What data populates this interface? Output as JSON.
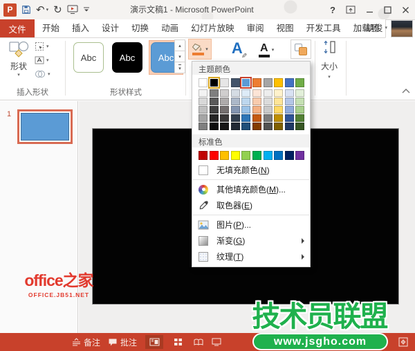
{
  "colors": {
    "accent": "#C8412B",
    "status_bar_bg": "#C8412B",
    "slide_fill_blue": "#5B9BD5",
    "fill_button_highlight": "#FADBC6",
    "watermark_red": "#E23A2E",
    "watermark_green": "#1FB14D"
  },
  "icons": {
    "powerpoint_logo": "P",
    "undo": "↶",
    "redo": "↻",
    "caret": "▾",
    "help": "?",
    "scroll_up": "▴",
    "scroll_down": "▾",
    "letter_a": "A",
    "pencil": "✎"
  },
  "title_bar": {
    "title": "演示文稿1 - Microsoft PowerPoint"
  },
  "tabs": {
    "file": "文件",
    "items": [
      "开始",
      "插入",
      "设计",
      "切换",
      "动画",
      "幻灯片放映",
      "审阅",
      "视图",
      "开发工具",
      "加载项"
    ],
    "contextual": "格式",
    "user": "胡俊"
  },
  "ribbon": {
    "insert_shapes": {
      "group_label": "插入形状",
      "shapes_label": "形状"
    },
    "shape_styles": {
      "group_label": "形状样式",
      "styles": [
        {
          "label": "Abc",
          "bg": "#FFFFFF",
          "fg": "#404040",
          "border": "#AABF8F",
          "selected": false
        },
        {
          "label": "Abc",
          "bg": "#000000",
          "fg": "#FFFFFF",
          "border": "#000000",
          "selected": false
        },
        {
          "label": "Abc",
          "bg": "#5B9BD5",
          "fg": "#FFFFFF",
          "border": "#4A88C0",
          "selected": true
        }
      ]
    },
    "size": {
      "label": "大小"
    }
  },
  "fill_menu": {
    "theme_header": "主题颜色",
    "standard_header": "标准色",
    "theme_columns": [
      {
        "base": "#FFFFFF",
        "selected": "none",
        "tints": [
          "#F2F2F2",
          "#D8D8D8",
          "#BFBFBF",
          "#A5A5A5",
          "#7F7F7F"
        ]
      },
      {
        "base": "#000000",
        "selected": "gold",
        "tints": [
          "#7F7F7F",
          "#595959",
          "#3F3F3F",
          "#262626",
          "#0C0C0C"
        ]
      },
      {
        "base": "#E7E6E6",
        "selected": "none",
        "tints": [
          "#D0CECE",
          "#AEABAB",
          "#757070",
          "#3A3838",
          "#171616"
        ]
      },
      {
        "base": "#44546A",
        "selected": "none",
        "tints": [
          "#D5DCE4",
          "#ACB8C9",
          "#8495B1",
          "#323F4F",
          "#212934"
        ]
      },
      {
        "base": "#5B9BD5",
        "selected": "accent",
        "tints": [
          "#DDEBF7",
          "#BDD7EE",
          "#9BC2E6",
          "#2E75B6",
          "#1F4E79"
        ]
      },
      {
        "base": "#ED7D31",
        "selected": "none",
        "tints": [
          "#FCE4D6",
          "#F8CBAD",
          "#F4B083",
          "#C55A11",
          "#833C00"
        ]
      },
      {
        "base": "#A5A5A5",
        "selected": "none",
        "tints": [
          "#EDEDED",
          "#DBDBDB",
          "#C9C9C9",
          "#7B7B7B",
          "#525252"
        ]
      },
      {
        "base": "#FFC000",
        "selected": "none",
        "tints": [
          "#FFF2CC",
          "#FFE598",
          "#FFD965",
          "#BF8F00",
          "#806000"
        ]
      },
      {
        "base": "#4472C4",
        "selected": "none",
        "tints": [
          "#D9E2F3",
          "#B4C6E7",
          "#8EAADB",
          "#2E5496",
          "#1F3863"
        ]
      },
      {
        "base": "#70AD47",
        "selected": "none",
        "tints": [
          "#E2EFD9",
          "#C5E0B3",
          "#A8D08D",
          "#538135",
          "#375623"
        ]
      }
    ],
    "standard_colors": [
      "#C00000",
      "#FF0000",
      "#FFC000",
      "#FFFF00",
      "#92D050",
      "#00B050",
      "#00B0F0",
      "#0070C0",
      "#002060",
      "#7030A0"
    ],
    "items": [
      {
        "pre": "无填充颜色(",
        "key": "N",
        "post": ")",
        "icon": "no-fill-icon",
        "submenu": false
      },
      {
        "pre": "其他填充颜色(",
        "key": "M",
        "post": ")...",
        "icon": "color-wheel-icon",
        "submenu": false
      },
      {
        "pre": "取色器(",
        "key": "E",
        "post": ")",
        "icon": "eyedropper-icon",
        "submenu": false
      },
      {
        "pre": "图片(",
        "key": "P",
        "post": ")...",
        "icon": "picture-icon",
        "submenu": false
      },
      {
        "pre": "渐变(",
        "key": "G",
        "post": ")",
        "icon": "gradient-icon",
        "submenu": true
      },
      {
        "pre": "纹理(",
        "key": "T",
        "post": ")",
        "icon": "texture-icon",
        "submenu": true
      }
    ]
  },
  "slides_panel": {
    "slide_number": "1"
  },
  "status_bar": {
    "notes": "备注",
    "comments": "批注"
  },
  "watermarks": {
    "left_title": "office之家",
    "left_sub": "OFFICE.JB51.NET",
    "right_title": "技术员联盟",
    "right_sub": "www.jsgho.com"
  }
}
